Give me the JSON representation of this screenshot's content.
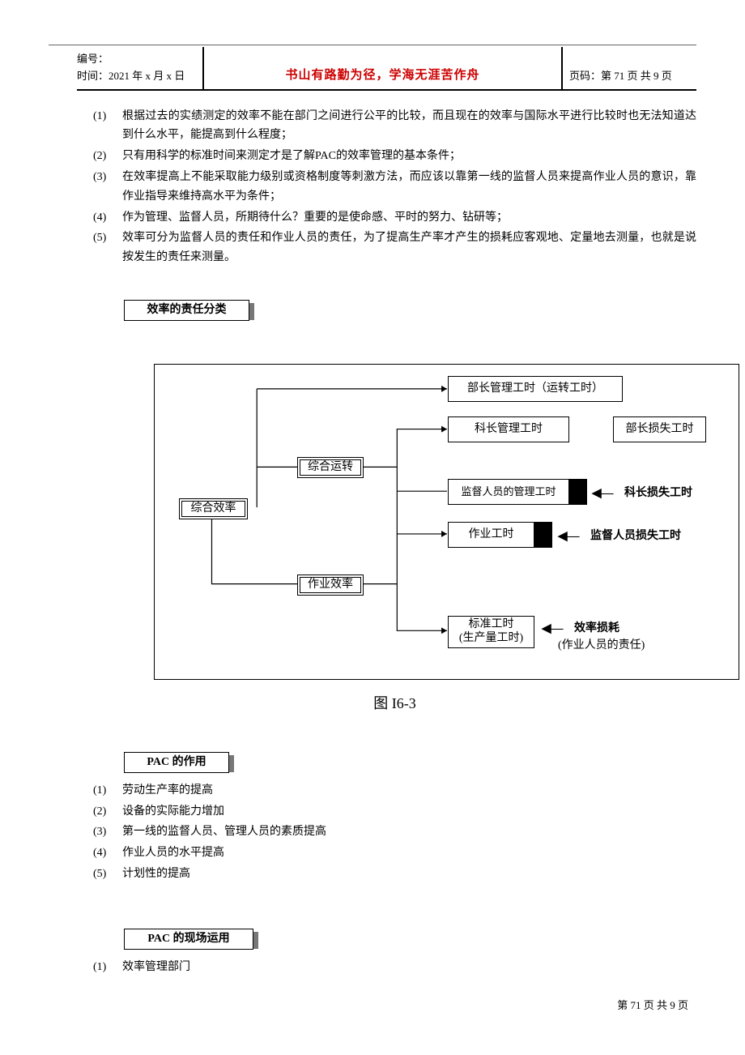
{
  "header": {
    "bianhao": "编号：",
    "time_label": "时间：2021 年 x 月 x 日",
    "motto": "书山有路勤为径，学海无涯苦作舟",
    "page_label": "页码：第 71 页  共 9 页"
  },
  "list1": [
    {
      "n": "(1)",
      "t": "根据过去的实绩测定的效率不能在部门之间进行公平的比较，而且现在的效率与国际水平进行比较时也无法知道达到什么水平，能提高到什么程度；"
    },
    {
      "n": "(2)",
      "t": "只有用科学的标准时间来测定才是了解PAC的效率管理的基本条件；"
    },
    {
      "n": "(3)",
      "t": "在效率提高上不能采取能力级别或资格制度等刺激方法，而应该以靠第一线的监督人员来提高作业人员的意识，靠作业指导来维持高水平为条件；"
    },
    {
      "n": "(4)",
      "t": "作为管理、监督人员，所期待什么？重要的是使命感、平时的努力、钻研等；"
    },
    {
      "n": "(5)",
      "t": "效率可分为监督人员的责任和作业人员的责任，为了提高生产率才产生的损耗应客观地、定量地去测量，也就是说按发生的责任来测量。"
    }
  ],
  "section1": "效率的责任分类",
  "diagram": {
    "left1": "综合效率",
    "left2": "综合运转",
    "left3": "作业效率",
    "r1": "部长管理工时（运转工时）",
    "r2a": "科长管理工时",
    "r2b": "部长损失工时",
    "r3": "监督人员的管理工时",
    "r4": "作业工时",
    "r5a": "标准工时",
    "r5b": "(生产量工时)",
    "note1": "科长损失工时",
    "note2": "监督人员损失工时",
    "note3a": "效率损耗",
    "note3b": "(作业人员的责任)"
  },
  "fig_caption": "图 I6-3",
  "section2": "PAC 的作用",
  "list2": [
    {
      "n": "(1)",
      "t": "劳动生产率的提高"
    },
    {
      "n": "(2)",
      "t": "设备的实际能力增加"
    },
    {
      "n": "(3)",
      "t": "第一线的监督人员、管理人员的素质提高"
    },
    {
      "n": "(4)",
      "t": "作业人员的水平提高"
    },
    {
      "n": "(5)",
      "t": "计划性的提高"
    }
  ],
  "section3": "PAC 的现场运用",
  "list3": [
    {
      "n": "(1)",
      "t": "效率管理部门"
    }
  ],
  "footer": "第 71 页 共 9 页"
}
